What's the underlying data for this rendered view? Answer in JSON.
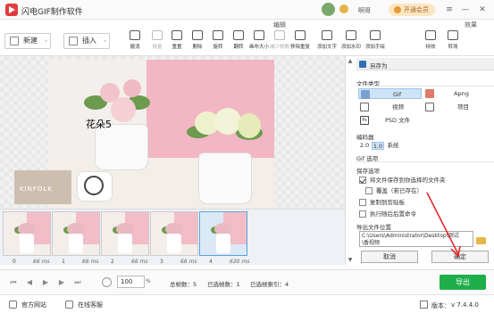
{
  "app": {
    "title": "闪电GIF制作软件",
    "user_name": "啊哥",
    "vip_label": "开通会员"
  },
  "ribbon": {
    "edit_header": "编辑",
    "effects_header": "效果",
    "new_label": "新建",
    "insert_label": "插入",
    "tools": [
      {
        "label": "撤消",
        "icon": "undo-icon",
        "enabled": true
      },
      {
        "label": "恢复",
        "icon": "redo-icon",
        "enabled": false
      },
      {
        "label": "重置",
        "icon": "reset-icon",
        "enabled": true
      },
      {
        "label": "删除",
        "icon": "delete-icon",
        "enabled": true
      },
      {
        "label": "旋转",
        "icon": "rotate-icon",
        "enabled": true
      },
      {
        "label": "翻转",
        "icon": "flip-icon",
        "enabled": true
      },
      {
        "label": "画布大小",
        "icon": "canvas-size-icon",
        "enabled": true
      },
      {
        "label": "减少帧数",
        "icon": "reduce-frames-icon",
        "enabled": false
      },
      {
        "label": "移除重复",
        "icon": "remove-duplicates-icon",
        "enabled": true
      },
      {
        "label": "添加文字",
        "icon": "add-text-icon",
        "enabled": true
      },
      {
        "label": "添加水印",
        "icon": "add-watermark-icon",
        "enabled": true
      },
      {
        "label": "添加手绘",
        "icon": "add-drawing-icon",
        "enabled": true
      },
      {
        "label": "特效",
        "icon": "effects-icon",
        "enabled": true
      },
      {
        "label": "转场",
        "icon": "transition-icon",
        "enabled": true
      }
    ]
  },
  "preview": {
    "frame_text": "花朵5",
    "book_text": "KINFOLK"
  },
  "save_panel": {
    "title": "另存为",
    "file_type_label": "文件类型",
    "types": {
      "gif": "Gif",
      "apng": "Apng",
      "video": "视频",
      "project": "项目",
      "psd": "PSD 文件"
    },
    "encoder_label": "编码器",
    "encoders": [
      "2.0",
      "1.0",
      "系统"
    ],
    "gif_options_label": "Gif 选项",
    "save_options_label": "保存选项",
    "options": [
      {
        "label": "将文件保存到你选择的文件夹",
        "checked": true
      },
      {
        "label": "覆盖（若已存在）",
        "checked": false
      },
      {
        "label": "复制到剪贴板",
        "checked": false
      },
      {
        "label": "执行随后后置命令",
        "checked": false
      }
    ],
    "export_location_label": "导出文件位置",
    "path_line1": "C:\\Users\\Administrator\\Desktop\\测试",
    "path_line2": "\\香视频",
    "cancel_label": "取消",
    "confirm_label": "确定"
  },
  "frames": [
    {
      "index": "0",
      "duration": "66 ms"
    },
    {
      "index": "1",
      "duration": "66 ms"
    },
    {
      "index": "2",
      "duration": "66 ms"
    },
    {
      "index": "3",
      "duration": "66 ms"
    },
    {
      "index": "4",
      "duration": "630 ms"
    }
  ],
  "status": {
    "zoom": "100",
    "zoom_unit": "%",
    "total_frames": "总帧数：5",
    "selected_frames": "已选帧数：1",
    "selected_index": "已选帧索引：4",
    "export_label": "导出"
  },
  "footer": {
    "website": "官方网站",
    "support": "在线客服",
    "version_label": "版本：",
    "version": "v 7.4.4.0"
  },
  "colors": {
    "accent_green": "#1fae4a",
    "logo_red": "#e23b3b",
    "arrow_red": "#e02020"
  }
}
